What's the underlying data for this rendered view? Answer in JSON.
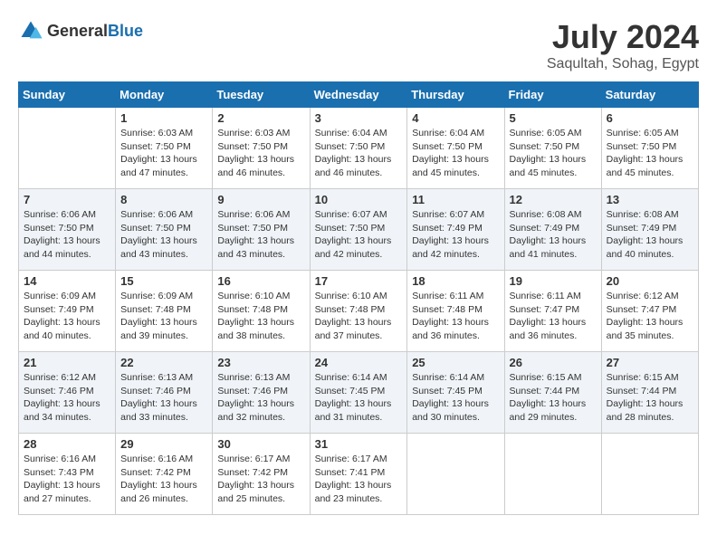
{
  "header": {
    "logo_general": "General",
    "logo_blue": "Blue",
    "month_year": "July 2024",
    "location": "Saqultah, Sohag, Egypt"
  },
  "days_of_week": [
    "Sunday",
    "Monday",
    "Tuesday",
    "Wednesday",
    "Thursday",
    "Friday",
    "Saturday"
  ],
  "weeks": [
    [
      {
        "day": "",
        "info": ""
      },
      {
        "day": "1",
        "info": "Sunrise: 6:03 AM\nSunset: 7:50 PM\nDaylight: 13 hours\nand 47 minutes."
      },
      {
        "day": "2",
        "info": "Sunrise: 6:03 AM\nSunset: 7:50 PM\nDaylight: 13 hours\nand 46 minutes."
      },
      {
        "day": "3",
        "info": "Sunrise: 6:04 AM\nSunset: 7:50 PM\nDaylight: 13 hours\nand 46 minutes."
      },
      {
        "day": "4",
        "info": "Sunrise: 6:04 AM\nSunset: 7:50 PM\nDaylight: 13 hours\nand 45 minutes."
      },
      {
        "day": "5",
        "info": "Sunrise: 6:05 AM\nSunset: 7:50 PM\nDaylight: 13 hours\nand 45 minutes."
      },
      {
        "day": "6",
        "info": "Sunrise: 6:05 AM\nSunset: 7:50 PM\nDaylight: 13 hours\nand 45 minutes."
      }
    ],
    [
      {
        "day": "7",
        "info": "Sunrise: 6:06 AM\nSunset: 7:50 PM\nDaylight: 13 hours\nand 44 minutes."
      },
      {
        "day": "8",
        "info": "Sunrise: 6:06 AM\nSunset: 7:50 PM\nDaylight: 13 hours\nand 43 minutes."
      },
      {
        "day": "9",
        "info": "Sunrise: 6:06 AM\nSunset: 7:50 PM\nDaylight: 13 hours\nand 43 minutes."
      },
      {
        "day": "10",
        "info": "Sunrise: 6:07 AM\nSunset: 7:50 PM\nDaylight: 13 hours\nand 42 minutes."
      },
      {
        "day": "11",
        "info": "Sunrise: 6:07 AM\nSunset: 7:49 PM\nDaylight: 13 hours\nand 42 minutes."
      },
      {
        "day": "12",
        "info": "Sunrise: 6:08 AM\nSunset: 7:49 PM\nDaylight: 13 hours\nand 41 minutes."
      },
      {
        "day": "13",
        "info": "Sunrise: 6:08 AM\nSunset: 7:49 PM\nDaylight: 13 hours\nand 40 minutes."
      }
    ],
    [
      {
        "day": "14",
        "info": "Sunrise: 6:09 AM\nSunset: 7:49 PM\nDaylight: 13 hours\nand 40 minutes."
      },
      {
        "day": "15",
        "info": "Sunrise: 6:09 AM\nSunset: 7:48 PM\nDaylight: 13 hours\nand 39 minutes."
      },
      {
        "day": "16",
        "info": "Sunrise: 6:10 AM\nSunset: 7:48 PM\nDaylight: 13 hours\nand 38 minutes."
      },
      {
        "day": "17",
        "info": "Sunrise: 6:10 AM\nSunset: 7:48 PM\nDaylight: 13 hours\nand 37 minutes."
      },
      {
        "day": "18",
        "info": "Sunrise: 6:11 AM\nSunset: 7:48 PM\nDaylight: 13 hours\nand 36 minutes."
      },
      {
        "day": "19",
        "info": "Sunrise: 6:11 AM\nSunset: 7:47 PM\nDaylight: 13 hours\nand 36 minutes."
      },
      {
        "day": "20",
        "info": "Sunrise: 6:12 AM\nSunset: 7:47 PM\nDaylight: 13 hours\nand 35 minutes."
      }
    ],
    [
      {
        "day": "21",
        "info": "Sunrise: 6:12 AM\nSunset: 7:46 PM\nDaylight: 13 hours\nand 34 minutes."
      },
      {
        "day": "22",
        "info": "Sunrise: 6:13 AM\nSunset: 7:46 PM\nDaylight: 13 hours\nand 33 minutes."
      },
      {
        "day": "23",
        "info": "Sunrise: 6:13 AM\nSunset: 7:46 PM\nDaylight: 13 hours\nand 32 minutes."
      },
      {
        "day": "24",
        "info": "Sunrise: 6:14 AM\nSunset: 7:45 PM\nDaylight: 13 hours\nand 31 minutes."
      },
      {
        "day": "25",
        "info": "Sunrise: 6:14 AM\nSunset: 7:45 PM\nDaylight: 13 hours\nand 30 minutes."
      },
      {
        "day": "26",
        "info": "Sunrise: 6:15 AM\nSunset: 7:44 PM\nDaylight: 13 hours\nand 29 minutes."
      },
      {
        "day": "27",
        "info": "Sunrise: 6:15 AM\nSunset: 7:44 PM\nDaylight: 13 hours\nand 28 minutes."
      }
    ],
    [
      {
        "day": "28",
        "info": "Sunrise: 6:16 AM\nSunset: 7:43 PM\nDaylight: 13 hours\nand 27 minutes."
      },
      {
        "day": "29",
        "info": "Sunrise: 6:16 AM\nSunset: 7:42 PM\nDaylight: 13 hours\nand 26 minutes."
      },
      {
        "day": "30",
        "info": "Sunrise: 6:17 AM\nSunset: 7:42 PM\nDaylight: 13 hours\nand 25 minutes."
      },
      {
        "day": "31",
        "info": "Sunrise: 6:17 AM\nSunset: 7:41 PM\nDaylight: 13 hours\nand 23 minutes."
      },
      {
        "day": "",
        "info": ""
      },
      {
        "day": "",
        "info": ""
      },
      {
        "day": "",
        "info": ""
      }
    ]
  ]
}
